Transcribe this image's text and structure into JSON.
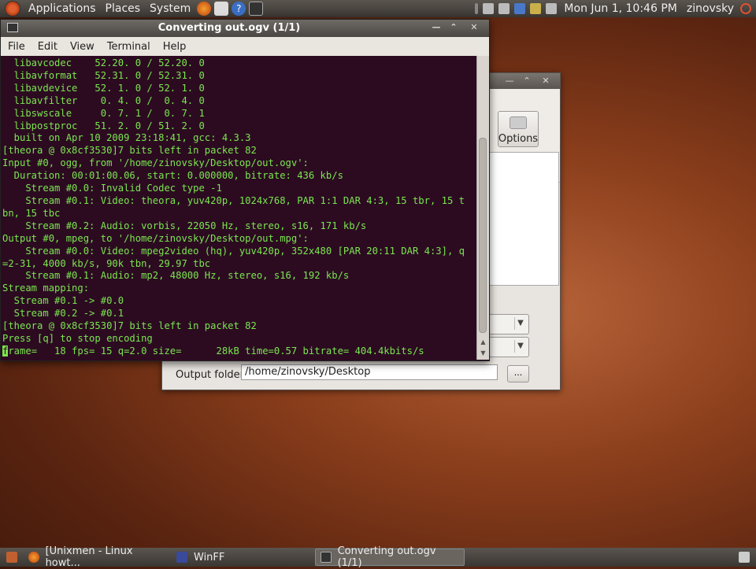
{
  "top_panel": {
    "menus": [
      "Applications",
      "Places",
      "System"
    ],
    "clock": "Mon Jun  1, 10:46 PM",
    "user": "zinovsky"
  },
  "terminal": {
    "title": "Converting out.ogv (1/1)",
    "menu": [
      "File",
      "Edit",
      "View",
      "Terminal",
      "Help"
    ],
    "lines": [
      "  libavcodec    52.20. 0 / 52.20. 0",
      "  libavformat   52.31. 0 / 52.31. 0",
      "  libavdevice   52. 1. 0 / 52. 1. 0",
      "  libavfilter    0. 4. 0 /  0. 4. 0",
      "  libswscale     0. 7. 1 /  0. 7. 1",
      "  libpostproc   51. 2. 0 / 51. 2. 0",
      "  built on Apr 10 2009 23:18:41, gcc: 4.3.3",
      "[theora @ 0x8cf3530]7 bits left in packet 82",
      "Input #0, ogg, from '/home/zinovsky/Desktop/out.ogv':",
      "  Duration: 00:01:00.06, start: 0.000000, bitrate: 436 kb/s",
      "    Stream #0.0: Invalid Codec type -1",
      "    Stream #0.1: Video: theora, yuv420p, 1024x768, PAR 1:1 DAR 4:3, 15 tbr, 15 t",
      "bn, 15 tbc",
      "    Stream #0.2: Audio: vorbis, 22050 Hz, stereo, s16, 171 kb/s",
      "Output #0, mpeg, to '/home/zinovsky/Desktop/out.mpg':",
      "    Stream #0.0: Video: mpeg2video (hq), yuv420p, 352x480 [PAR 20:11 DAR 4:3], q",
      "=2-31, 4000 kb/s, 90k tbn, 29.97 tbc",
      "    Stream #0.1: Audio: mp2, 48000 Hz, stereo, s16, 192 kb/s",
      "Stream mapping:",
      "  Stream #0.1 -> #0.0",
      "  Stream #0.2 -> #0.1",
      "[theora @ 0x8cf3530]7 bits left in packet 82",
      "Press [q] to stop encoding"
    ],
    "cursor_char": "f",
    "last_line_rest": "rame=   18 fps= 15 q=2.0 size=      28kB time=0.57 bitrate= 404.4kbits/s"
  },
  "winff": {
    "options_label": "Options",
    "output_folder_label": "Output folder",
    "output_folder_value": "/home/zinovsky/Desktop",
    "browse_label": "..."
  },
  "taskbar": {
    "tasks": [
      "[Unixmen - Linux howt...",
      "WinFF",
      "Converting out.ogv (1/1)"
    ]
  }
}
